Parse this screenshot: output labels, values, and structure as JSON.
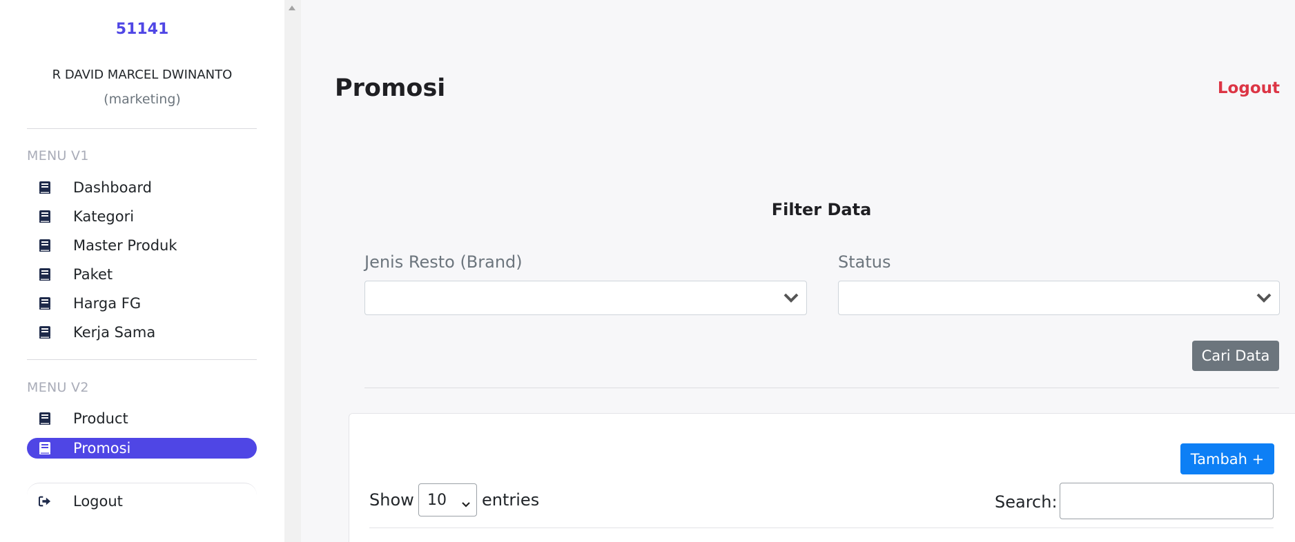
{
  "sidebar": {
    "user_id": "51141",
    "user_name": "R DAVID MARCEL DWINANTO",
    "user_role": "(marketing)",
    "section_v1": "MENU V1",
    "section_v2": "MENU V2",
    "menu_v1": [
      {
        "label": "Dashboard",
        "icon": "book-icon"
      },
      {
        "label": "Kategori",
        "icon": "book-icon"
      },
      {
        "label": "Master Produk",
        "icon": "book-icon"
      },
      {
        "label": "Paket",
        "icon": "book-icon"
      },
      {
        "label": "Harga FG",
        "icon": "book-icon"
      },
      {
        "label": "Kerja Sama",
        "icon": "book-icon"
      }
    ],
    "menu_v2": [
      {
        "label": "Product",
        "icon": "book-icon",
        "active": false
      },
      {
        "label": "Promosi",
        "icon": "book-icon",
        "active": true
      }
    ],
    "logout_label": "Logout",
    "logout_icon": "sign-out-icon"
  },
  "header": {
    "title": "Promosi",
    "logout_label": "Logout"
  },
  "filter": {
    "title": "Filter Data",
    "brand_label": "Jenis Resto (Brand)",
    "brand_value": "",
    "status_label": "Status",
    "status_value": "",
    "search_button": "Cari Data"
  },
  "table": {
    "add_button": "Tambah +",
    "show_label": "Show",
    "entries_value": "10",
    "entries_label": "entries",
    "search_label": "Search:",
    "search_value": ""
  },
  "colors": {
    "accent": "#4f46e5",
    "danger": "#dc3545",
    "primary": "#0d7ff5",
    "secondary": "#6c757d"
  }
}
